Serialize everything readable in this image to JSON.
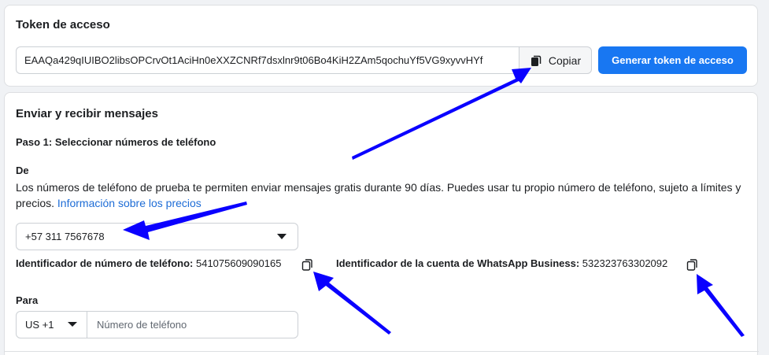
{
  "token_section": {
    "title": "Token de acceso",
    "token_value": "EAAQa429qIUIBO2libsOPCrvOt1AciHn0eXXZCNRf7dsxlnr9t06Bo4KiH2ZAm5qochuYf5VG9xyvvHYf",
    "copy_label": "Copiar",
    "generate_label": "Generar token de acceso"
  },
  "messaging_section": {
    "title": "Enviar y recibir mensajes",
    "step1_label": "Paso 1: Seleccionar números de teléfono",
    "from_label": "De",
    "description": "Los números de teléfono de prueba te permiten enviar mensajes gratis durante 90 días. Puedes usar tu propio número de teléfono, sujeto a límites y precios. ",
    "pricing_link": "Información sobre los precios",
    "from_number": "+57 311 7567678",
    "phone_id_label": "Identificador de número de teléfono:",
    "phone_id_value": "541075609090165",
    "waba_id_label": "Identificador de la cuenta de WhatsApp Business:",
    "waba_id_value": "532323763302092",
    "to_label": "Para",
    "country_code": "US +1",
    "phone_placeholder": "Número de teléfono"
  },
  "icons": {
    "copy": "copy-icon",
    "dropdown": "chevron-down-icon"
  },
  "colors": {
    "primary_button": "#1877f2",
    "link": "#1d6cd6",
    "annotation_arrow": "#0a00ff"
  }
}
